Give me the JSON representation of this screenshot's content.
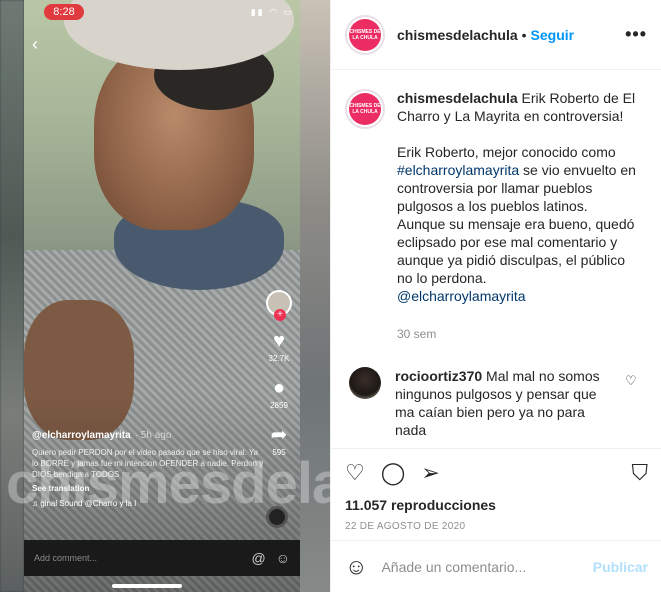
{
  "media": {
    "status_time": "8:28",
    "status_icons": "▮▮ ◠ ▭",
    "tiktok_user": "@elcharroylamayrita",
    "tiktok_ago": "· 5h ago",
    "tiktok_caption": "Quiero pedir PERDON por el video pasado que se hiso viral. Ya lo BORRE y jamas fue mi intencion OFENDER a nadie. Perdon y DIOS bendiga a TODOS",
    "see_translation": "See translation",
    "sound": "♫ ginal Sound    @Charro y la I",
    "likes": "32.7K",
    "comments": "2859",
    "shares": "595",
    "watermark": "chismesdelac",
    "add_comment_placeholder": "Add comment...",
    "icons": {
      "back": "chevron-left-icon",
      "like": "heart-icon",
      "comment": "comment-bubble-icon",
      "share": "share-arrow-icon",
      "at": "at-sign-icon",
      "emoji": "smiley-icon"
    }
  },
  "post": {
    "username": "chismesdelachula",
    "follow_label": "Seguir",
    "more_label": "•••",
    "avatar_text": "CHISMES DE LA CHULA",
    "caption_headline": "Erik Roberto de El Charro y La Mayrita en controversia!",
    "caption_p1_before": "Erik Roberto, mejor conocido como ",
    "caption_hashtag": "#elcharroylamayrita",
    "caption_p1_after": " se vio envuelto en controversia por llamar pueblos pulgosos a los pueblos latinos. Aunque su mensaje era bueno, quedó eclipsado por ese mal comentario y aunque ya pidió disculpas, el público no lo perdona.",
    "caption_mention": "@elcharroylamayrita",
    "caption_time": "30 sem",
    "comment": {
      "username": "rocioortiz370",
      "text": "Mal mal no somos ningunos pulgosos y pensar que ma caían bien pero ya no para nada"
    },
    "views": "11.057 reproducciones",
    "date": "22 DE AGOSTO DE 2020",
    "add_comment_placeholder": "Añade un comentario...",
    "publish_label": "Publicar",
    "accent_color": "#0095f6",
    "brand_color": "#ec2d63"
  }
}
